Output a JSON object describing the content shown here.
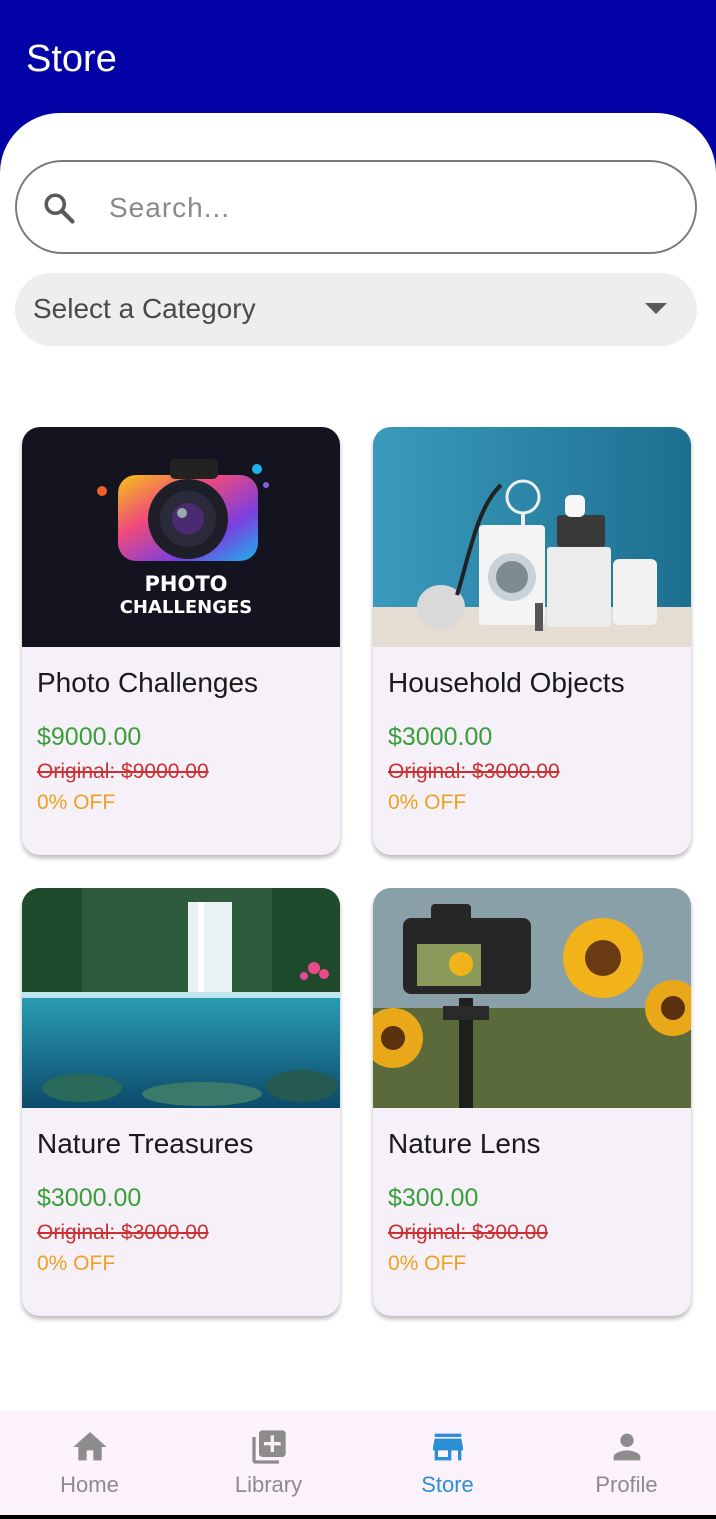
{
  "app_bar": {
    "title": "Store"
  },
  "search": {
    "placeholder": "Search...",
    "value": ""
  },
  "category": {
    "selected": "Select a Category"
  },
  "products": [
    {
      "title": "Photo Challenges",
      "price": "$9000.00",
      "original": "Original: $9000.00",
      "discount": "0% OFF",
      "image_logo_text": [
        "PHOTO",
        "CHALLENGES"
      ]
    },
    {
      "title": "Household Objects",
      "price": "$3000.00",
      "original": "Original: $3000.00",
      "discount": "0% OFF"
    },
    {
      "title": "Nature Treasures",
      "price": "$3000.00",
      "original": "Original: $3000.00",
      "discount": "0% OFF"
    },
    {
      "title": "Nature Lens",
      "price": "$300.00",
      "original": "Original: $300.00",
      "discount": "0% OFF"
    }
  ],
  "bottom_nav": {
    "items": [
      {
        "label": "Home",
        "icon": "home-icon"
      },
      {
        "label": "Library",
        "icon": "library-add-icon"
      },
      {
        "label": "Store",
        "icon": "store-icon",
        "active": true
      },
      {
        "label": "Profile",
        "icon": "person-icon"
      }
    ]
  },
  "colors": {
    "primary": "#0202a6",
    "price": "#3a9e3a",
    "original_price": "#cc3030",
    "discount": "#f0a020",
    "nav_active": "#2a8fd6",
    "nav_inactive": "#8c8c8c"
  }
}
